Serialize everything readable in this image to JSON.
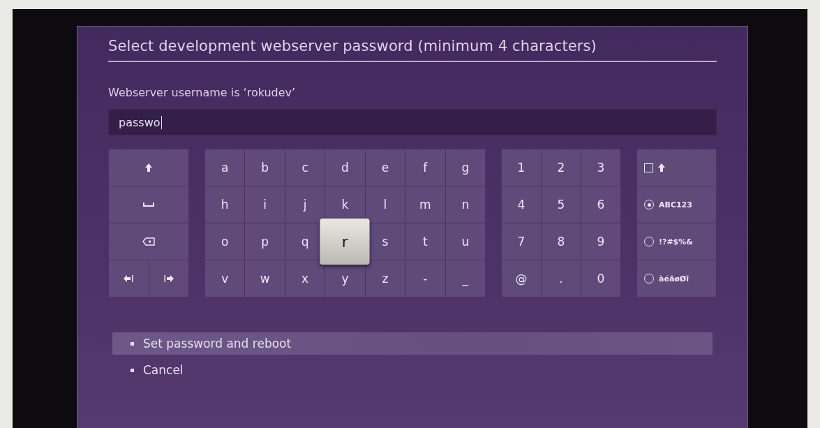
{
  "dialog": {
    "title": "Select development webserver password (minimum 4 characters)",
    "subtitle": "Webserver username is ‘rokudev’",
    "password_field": {
      "value": "passwo"
    }
  },
  "keyboard": {
    "control_keys": [
      {
        "kind": "shift"
      },
      {
        "kind": "space"
      },
      {
        "kind": "backspace"
      },
      {
        "kind": "cursor"
      }
    ],
    "letter_keys": [
      {
        "label": "a",
        "selected": false
      },
      {
        "label": "b",
        "selected": false
      },
      {
        "label": "c",
        "selected": false
      },
      {
        "label": "d",
        "selected": false
      },
      {
        "label": "e",
        "selected": false
      },
      {
        "label": "f",
        "selected": false
      },
      {
        "label": "g",
        "selected": false
      },
      {
        "label": "h",
        "selected": false
      },
      {
        "label": "i",
        "selected": false
      },
      {
        "label": "j",
        "selected": false
      },
      {
        "label": "k",
        "selected": false
      },
      {
        "label": "l",
        "selected": false
      },
      {
        "label": "m",
        "selected": false
      },
      {
        "label": "n",
        "selected": false
      },
      {
        "label": "o",
        "selected": false
      },
      {
        "label": "p",
        "selected": false
      },
      {
        "label": "q",
        "selected": false
      },
      {
        "label": "r",
        "selected": true
      },
      {
        "label": "s",
        "selected": false
      },
      {
        "label": "t",
        "selected": false
      },
      {
        "label": "u",
        "selected": false
      },
      {
        "label": "v",
        "selected": false
      },
      {
        "label": "w",
        "selected": false
      },
      {
        "label": "x",
        "selected": false
      },
      {
        "label": "y",
        "selected": false
      },
      {
        "label": "z",
        "selected": false
      },
      {
        "label": "-",
        "selected": false
      },
      {
        "label": "_",
        "selected": false
      }
    ],
    "number_keys": [
      {
        "label": "1",
        "selected": false
      },
      {
        "label": "2",
        "selected": false
      },
      {
        "label": "3",
        "selected": false
      },
      {
        "label": "4",
        "selected": false
      },
      {
        "label": "5",
        "selected": false
      },
      {
        "label": "6",
        "selected": false
      },
      {
        "label": "7",
        "selected": false
      },
      {
        "label": "8",
        "selected": false
      },
      {
        "label": "9",
        "selected": false
      },
      {
        "label": "@",
        "selected": false
      },
      {
        "label": ".",
        "selected": false
      },
      {
        "label": "0",
        "selected": false
      }
    ],
    "mode_keys": [
      {
        "kind": "caps-lock",
        "checked": false
      },
      {
        "kind": "radio",
        "label": "ABC123",
        "selected": true
      },
      {
        "kind": "radio",
        "label": "!?#$%&",
        "selected": false
      },
      {
        "kind": "radio",
        "label": "àéâøØî",
        "selected": false
      }
    ]
  },
  "menu": [
    {
      "label": "Set password and reboot",
      "selected": true
    },
    {
      "label": "Cancel",
      "selected": false
    }
  ]
}
